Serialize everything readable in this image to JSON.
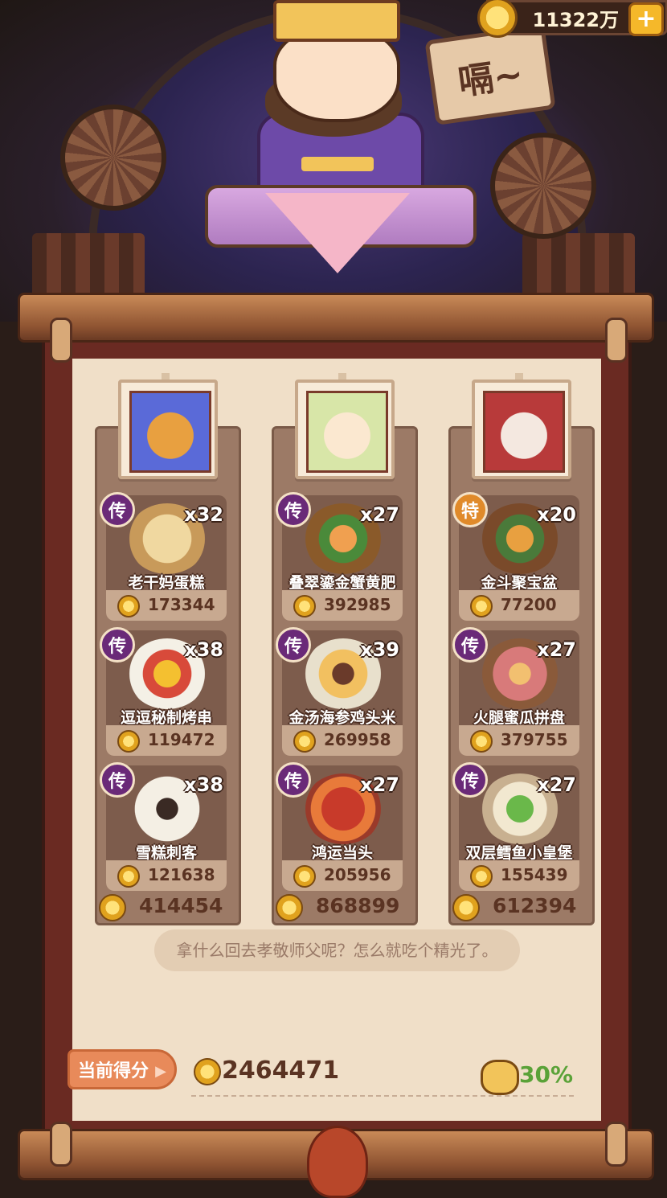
{
  "header": {
    "coin_amount": "11322万",
    "plus_label": "+",
    "speech_sign": "嗝~"
  },
  "columns": [
    {
      "dishes": [
        {
          "tag": "传",
          "tag_color": "#6a2a78",
          "name": "老干妈蛋糕",
          "count": "x32",
          "price": "173344"
        },
        {
          "tag": "传",
          "tag_color": "#6a2a78",
          "name": "逗逗秘制烤串",
          "count": "x38",
          "price": "119472"
        },
        {
          "tag": "传",
          "tag_color": "#6a2a78",
          "name": "雪糕刺客",
          "count": "x38",
          "price": "121638"
        }
      ],
      "total": "414454"
    },
    {
      "dishes": [
        {
          "tag": "传",
          "tag_color": "#6a2a78",
          "name": "叠翠鎏金蟹黄肥",
          "count": "x27",
          "price": "392985"
        },
        {
          "tag": "传",
          "tag_color": "#6a2a78",
          "name": "金汤海参鸡头米",
          "count": "x39",
          "price": "269958"
        },
        {
          "tag": "传",
          "tag_color": "#6a2a78",
          "name": "鸿运当头",
          "count": "x27",
          "price": "205956"
        }
      ],
      "total": "868899"
    },
    {
      "dishes": [
        {
          "tag": "特",
          "tag_color": "#e08a2a",
          "name": "金斗聚宝盆",
          "count": "x20",
          "price": "77200"
        },
        {
          "tag": "传",
          "tag_color": "#6a2a78",
          "name": "火腿蜜瓜拼盘",
          "count": "x27",
          "price": "379755"
        },
        {
          "tag": "传",
          "tag_color": "#6a2a78",
          "name": "双层鳕鱼小皇堡",
          "count": "x27",
          "price": "155439"
        }
      ],
      "total": "612394"
    }
  ],
  "dialog_text": "拿什么回去孝敬师父呢？怎么就吃个精光了。",
  "score": {
    "button_label": "当前得分",
    "value": "2464471",
    "bonus": "30%"
  },
  "colors": {
    "paper": "#f0dfc8",
    "column_bg": "#9c7a66",
    "bonus_green": "#5aa238",
    "score_button": "#e88a5a"
  }
}
